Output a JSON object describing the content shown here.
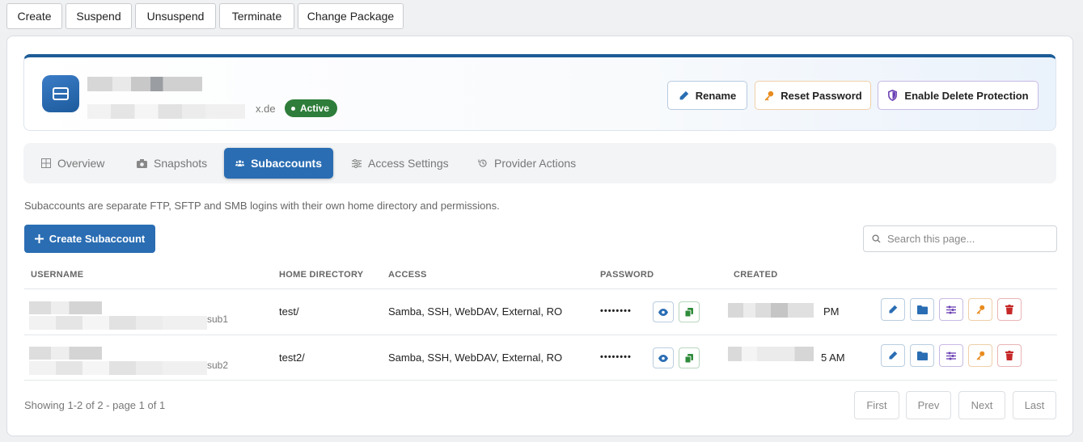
{
  "toolbar": {
    "create": "Create",
    "suspend": "Suspend",
    "unsuspend": "Unsuspend",
    "terminate": "Terminate",
    "change_package": "Change Package"
  },
  "header": {
    "name_suffix": "x.de",
    "status": "Active",
    "status_color": "#2e7d3a",
    "accent_color": "#1c5c97",
    "rename": "Rename",
    "reset_password": "Reset Password",
    "enable_delete_protection": "Enable Delete Protection"
  },
  "tabs": [
    {
      "label": "Overview",
      "icon": "grid-icon",
      "active": false
    },
    {
      "label": "Snapshots",
      "icon": "camera-icon",
      "active": false
    },
    {
      "label": "Subaccounts",
      "icon": "users-icon",
      "active": true
    },
    {
      "label": "Access Settings",
      "icon": "sliders-icon",
      "active": false
    },
    {
      "label": "Provider Actions",
      "icon": "history-icon",
      "active": false
    }
  ],
  "description": "Subaccounts are separate FTP, SFTP and SMB logins with their own home directory and permissions.",
  "create_subaccount": "Create Subaccount",
  "search": {
    "placeholder": "Search this page..."
  },
  "table": {
    "headers": [
      "USERNAME",
      "HOME DIRECTORY",
      "ACCESS",
      "PASSWORD",
      "CREATED"
    ],
    "rows": [
      {
        "username_suffix": "sub1",
        "home": "test/",
        "access": "Samba, SSH, WebDAV, External, RO",
        "password": "••••••••",
        "created_suffix": "PM"
      },
      {
        "username_suffix": "sub2",
        "home": "test2/",
        "access": "Samba, SSH, WebDAV, External, RO",
        "password": "••••••••",
        "created_suffix": "5 AM"
      }
    ]
  },
  "pagination": {
    "summary": "Showing 1-2 of 2 - page 1 of 1",
    "first": "First",
    "prev": "Prev",
    "next": "Next",
    "last": "Last"
  }
}
